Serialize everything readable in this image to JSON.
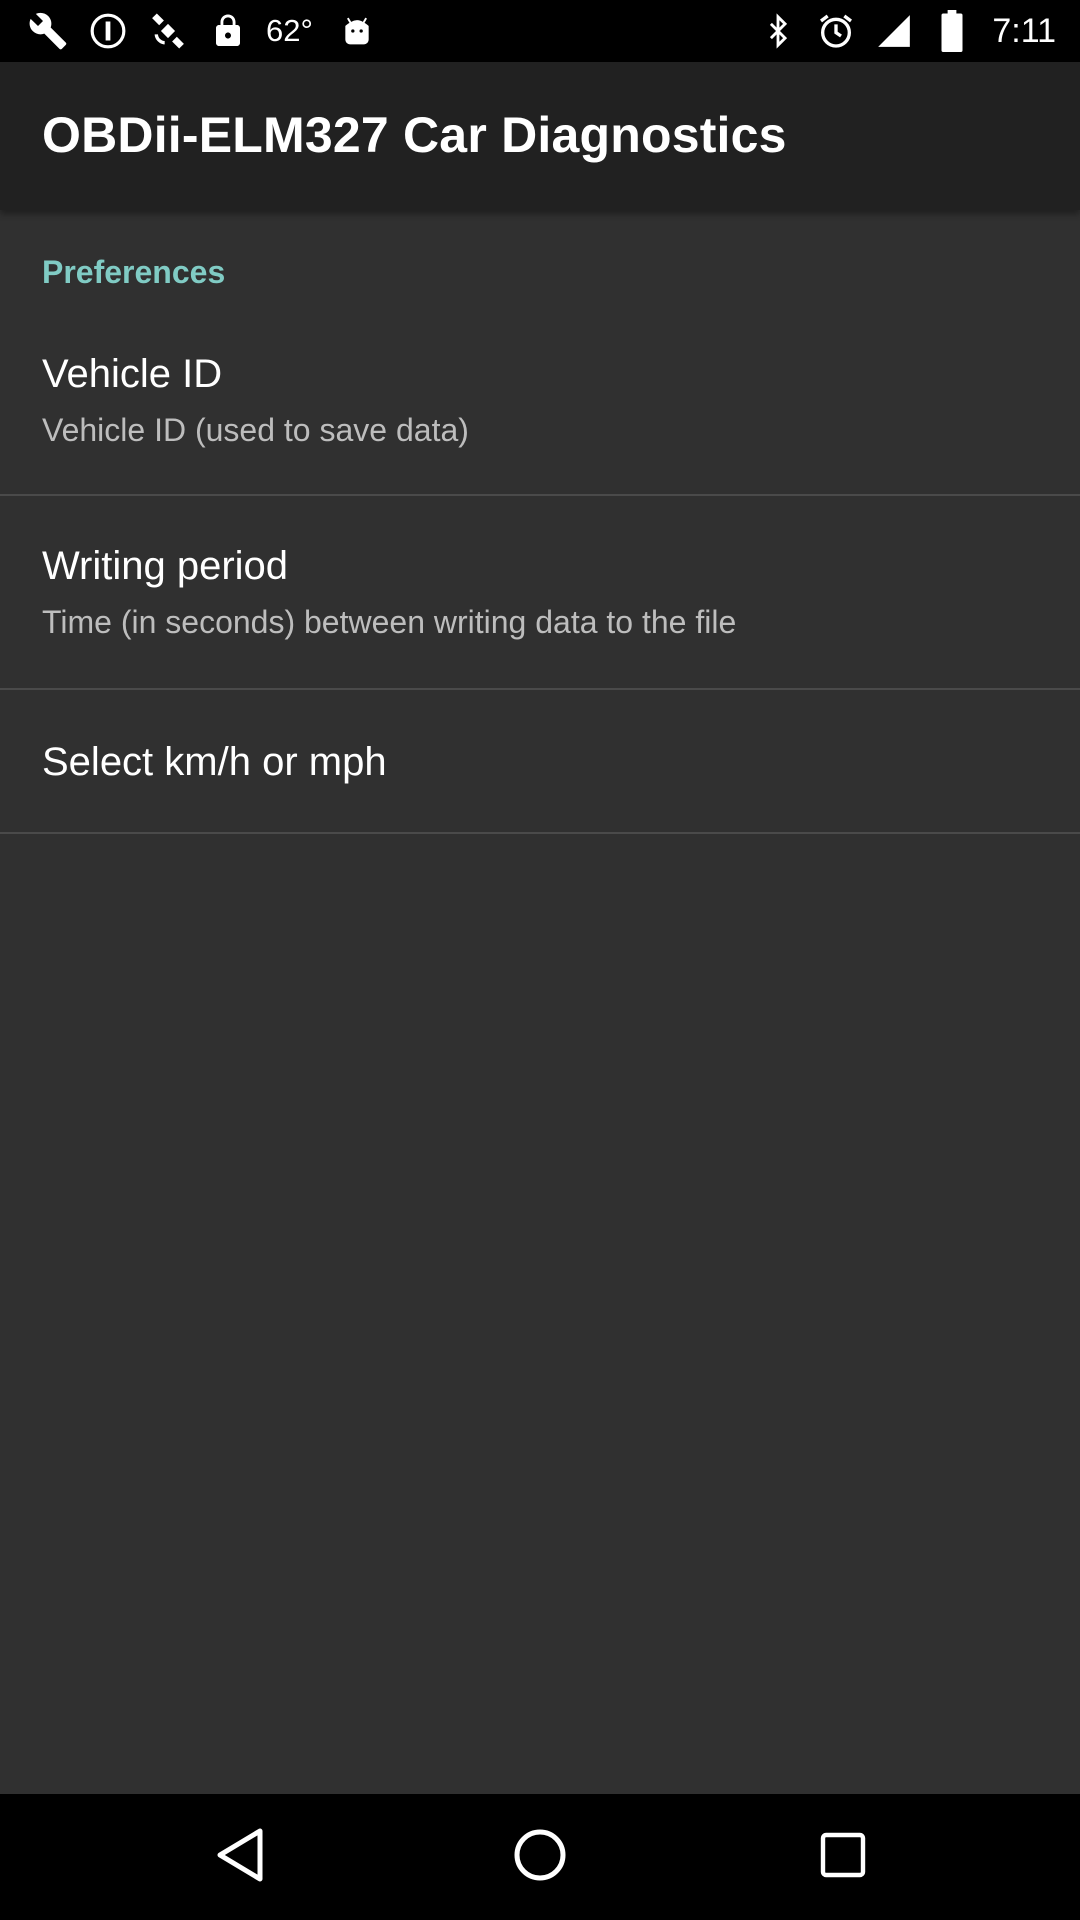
{
  "status_bar": {
    "icons_left": [
      "wrench-icon",
      "alert-circle-icon",
      "satellite-gps-icon",
      "lock-icon"
    ],
    "temperature": "62°",
    "icons_left_after": [
      "android-icon"
    ],
    "icons_right": [
      "bluetooth-icon",
      "alarm-clock-icon",
      "signal-icon",
      "battery-icon"
    ],
    "time": "7:11"
  },
  "app_bar": {
    "title": "OBDii-ELM327 Car Diagnostics"
  },
  "preferences": {
    "category": "Preferences",
    "items": [
      {
        "title": "Vehicle ID",
        "summary": "Vehicle ID (used to save data)"
      },
      {
        "title": "Writing period",
        "summary": "Time (in seconds) between writing data to the file"
      },
      {
        "title": "Select km/h or mph",
        "summary": ""
      }
    ]
  },
  "nav_bar": {
    "buttons": [
      "back-icon",
      "home-icon",
      "recents-icon"
    ]
  },
  "colors": {
    "background": "#303030",
    "app_bar": "#212121",
    "accent": "#80cbc4",
    "divider": "#4a4a4a"
  }
}
